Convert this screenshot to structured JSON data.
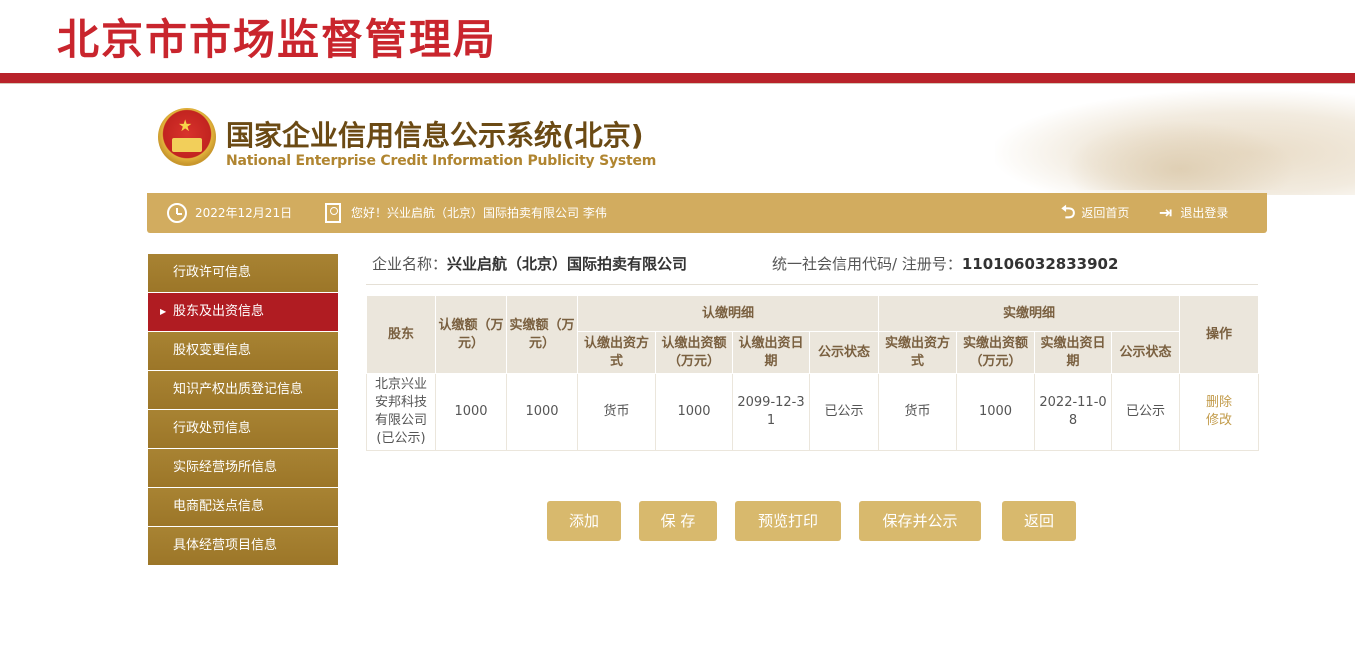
{
  "header": {
    "bureau_title": "北京市市场监督管理局",
    "system_title_cn": "国家企业信用信息公示系统(北京)",
    "system_title_en": "National Enterprise Credit Information Publicity System"
  },
  "infobar": {
    "date": "2022年12月21日",
    "greeting": "您好！兴业启航（北京）国际拍卖有限公司  李伟",
    "home_label": "返回首页",
    "logout_label": "退出登录"
  },
  "sidebar": {
    "items": [
      {
        "label": "行政许可信息"
      },
      {
        "label": "股东及出资信息"
      },
      {
        "label": "股权变更信息"
      },
      {
        "label": "知识产权出质登记信息"
      },
      {
        "label": "行政处罚信息"
      },
      {
        "label": "实际经营场所信息"
      },
      {
        "label": "电商配送点信息"
      },
      {
        "label": "具体经营项目信息"
      }
    ]
  },
  "enterprise": {
    "name_label": "企业名称：",
    "name": "兴业启航（北京）国际拍卖有限公司",
    "code_label": "统一社会信用代码/ 注册号：",
    "code": "110106032833902"
  },
  "table": {
    "h_shareholder": "股东",
    "h_subscribed": "认缴额（万元）",
    "h_paid": "实缴额（万元）",
    "h_sub_detail": "认缴明细",
    "h_paid_detail": "实缴明细",
    "h_op": "操作",
    "h_sub_method": "认缴出资方式",
    "h_sub_amount": "认缴出资额（万元）",
    "h_sub_date": "认缴出资日期",
    "h_sub_status": "公示状态",
    "h_paid_method": "实缴出资方式",
    "h_paid_amount": "实缴出资额（万元）",
    "h_paid_date": "实缴出资日期",
    "h_paid_status": "公示状态",
    "row": {
      "shareholder": "北京兴业安邦科技有限公司(已公示)",
      "subscribed": "1000",
      "paid": "1000",
      "sub_method": "货币",
      "sub_amount": "1000",
      "sub_date": "2099-12-31",
      "sub_status": "已公示",
      "paid_method": "货币",
      "paid_amount": "1000",
      "paid_date": "2022-11-08",
      "paid_status": "已公示",
      "delete": "删除",
      "edit": "修改"
    }
  },
  "buttons": {
    "add": "添加",
    "save": "保 存",
    "preview": "预览打印",
    "save_publish": "保存并公示",
    "back": "返回"
  }
}
